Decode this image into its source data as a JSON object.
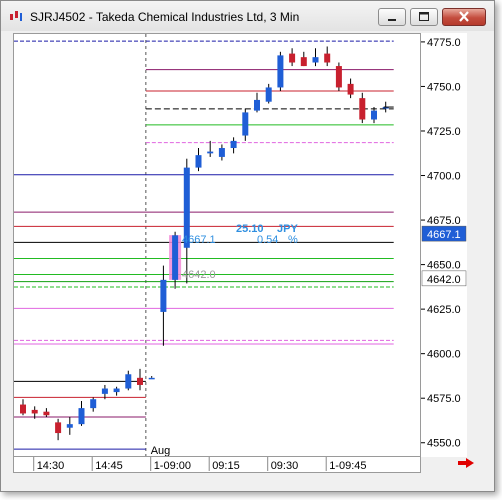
{
  "window": {
    "title": "SJRJ4502 - Takeda Chemical Industries Ltd, 3 Min",
    "icon": "candlestick-app-icon",
    "buttons": [
      "minimize",
      "maximize",
      "close"
    ]
  },
  "colors": {
    "bull": "#1f5ed6",
    "bear": "#c8202e",
    "highlight": "#f28ad6"
  },
  "annotation": {
    "change_value": "25.10",
    "change_currency": "JPY",
    "high_label": "4667.1",
    "pct_value": "0.54",
    "pct_sign": "%",
    "low_label": "4642.0"
  },
  "chart_data": {
    "type": "candlestick",
    "ylim": [
      4542,
      4780
    ],
    "y_ticks": [
      "4775.0",
      "4750.0",
      "4725.0",
      "4700.0",
      "4675.0",
      "4650.0",
      "4625.0",
      "4600.0",
      "4575.0",
      "4550.0"
    ],
    "price_markers": [
      {
        "value": "4667.1",
        "bg": "#1f5ed6",
        "fg": "#ffffff"
      },
      {
        "value": "4642.0",
        "bg": "#ffffff",
        "fg": "#000000"
      }
    ],
    "x_labels": [
      {
        "text": "14:30",
        "bar": 1
      },
      {
        "text": "14:45",
        "bar": 6
      },
      {
        "text": "1-09:00",
        "bar": 11
      },
      {
        "text": "09:15",
        "bar": 16
      },
      {
        "text": "09:30",
        "bar": 21
      },
      {
        "text": "1-09:45",
        "bar": 26
      }
    ],
    "month_label": {
      "text": "Aug",
      "bar": 11
    },
    "session_break_bar": 10.5,
    "candles": [
      {
        "o": 4572,
        "h": 4575,
        "l": 4566,
        "c": 4567
      },
      {
        "o": 4569,
        "h": 4571,
        "l": 4564,
        "c": 4567
      },
      {
        "o": 4568,
        "h": 4570,
        "l": 4565,
        "c": 4566
      },
      {
        "o": 4562,
        "h": 4564,
        "l": 4552,
        "c": 4556
      },
      {
        "o": 4559,
        "h": 4565,
        "l": 4555,
        "c": 4561
      },
      {
        "o": 4561,
        "h": 4574,
        "l": 4560,
        "c": 4570
      },
      {
        "o": 4570,
        "h": 4576,
        "l": 4568,
        "c": 4575
      },
      {
        "o": 4578,
        "h": 4583,
        "l": 4575,
        "c": 4581
      },
      {
        "o": 4579,
        "h": 4582,
        "l": 4577,
        "c": 4581
      },
      {
        "o": 4581,
        "h": 4591,
        "l": 4580,
        "c": 4589
      },
      {
        "o": 4587,
        "h": 4592,
        "l": 4580,
        "c": 4583
      },
      {
        "o": 4587,
        "h": 4588,
        "l": 4587,
        "c": 4587
      },
      {
        "o": 4624,
        "h": 4650,
        "l": 4605,
        "c": 4642
      },
      {
        "o": 4642,
        "h": 4669,
        "l": 4637,
        "c": 4667
      },
      {
        "o": 4660,
        "h": 4710,
        "l": 4640,
        "c": 4705
      },
      {
        "o": 4705,
        "h": 4716,
        "l": 4703,
        "c": 4712
      },
      {
        "o": 4713,
        "h": 4720,
        "l": 4711,
        "c": 4714
      },
      {
        "o": 4711,
        "h": 4718,
        "l": 4709,
        "c": 4716
      },
      {
        "o": 4716,
        "h": 4722,
        "l": 4713,
        "c": 4720
      },
      {
        "o": 4723,
        "h": 4738,
        "l": 4720,
        "c": 4736
      },
      {
        "o": 4737,
        "h": 4747,
        "l": 4736,
        "c": 4743
      },
      {
        "o": 4742,
        "h": 4752,
        "l": 4741,
        "c": 4750
      },
      {
        "o": 4750,
        "h": 4770,
        "l": 4748,
        "c": 4768
      },
      {
        "o": 4769,
        "h": 4772,
        "l": 4762,
        "c": 4764
      },
      {
        "o": 4767,
        "h": 4770,
        "l": 4762,
        "c": 4762
      },
      {
        "o": 4764,
        "h": 4772,
        "l": 4762,
        "c": 4767
      },
      {
        "o": 4769,
        "h": 4773,
        "l": 4762,
        "c": 4764
      },
      {
        "o": 4762,
        "h": 4764,
        "l": 4748,
        "c": 4750
      },
      {
        "o": 4752,
        "h": 4755,
        "l": 4744,
        "c": 4746
      },
      {
        "o": 4744,
        "h": 4747,
        "l": 4730,
        "c": 4732
      },
      {
        "o": 4732,
        "h": 4739,
        "l": 4730,
        "c": 4737
      },
      {
        "o": 4739,
        "h": 4742,
        "l": 4736,
        "c": 4739
      }
    ],
    "levels_previous": [
      {
        "y": 4776,
        "color": "#1a1aa8",
        "dash": "4,2"
      },
      {
        "y": 4547,
        "color": "#1a1aa8",
        "dash": ""
      },
      {
        "y": 4585,
        "color": "#000000",
        "dash": ""
      },
      {
        "y": 4576,
        "color": "#c8202e",
        "dash": ""
      },
      {
        "y": 4565,
        "color": "#8a1a6a",
        "dash": ""
      }
    ],
    "levels_current": [
      {
        "y": 4776,
        "color": "#1a1aa8",
        "dash": "4,2"
      },
      {
        "y": 4760,
        "color": "#8a1a6a",
        "dash": ""
      },
      {
        "y": 4748,
        "color": "#c8202e",
        "dash": ""
      },
      {
        "y": 4738,
        "color": "#000000",
        "dash": "6,3"
      },
      {
        "y": 4729,
        "color": "#22bb22",
        "dash": ""
      },
      {
        "y": 4719,
        "color": "#e066e0",
        "dash": "4,2"
      }
    ],
    "levels_full": [
      {
        "y": 4701,
        "color": "#1a1aa8",
        "dash": ""
      },
      {
        "y": 4680,
        "color": "#8a1a6a",
        "dash": ""
      },
      {
        "y": 4672,
        "color": "#c8202e",
        "dash": ""
      },
      {
        "y": 4663,
        "color": "#000000",
        "dash": ""
      },
      {
        "y": 4654,
        "color": "#22bb22",
        "dash": ""
      },
      {
        "y": 4645,
        "color": "#22bb22",
        "dash": ""
      },
      {
        "y": 4641,
        "color": "#10a010",
        "dash": ""
      },
      {
        "y": 4638,
        "color": "#22bb22",
        "dash": "4,2"
      },
      {
        "y": 4626,
        "color": "#e066e0",
        "dash": ""
      },
      {
        "y": 4608,
        "color": "#e066e0",
        "dash": "4,2"
      },
      {
        "y": 4606,
        "color": "#e066e0",
        "dash": ""
      }
    ]
  }
}
